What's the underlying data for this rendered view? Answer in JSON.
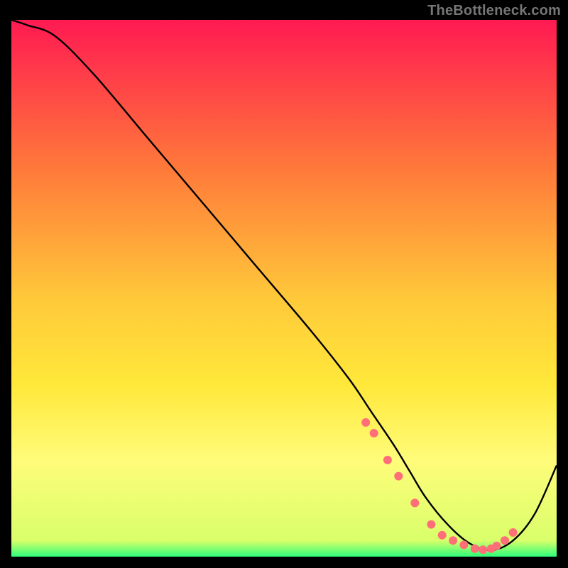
{
  "attribution": "TheBottleneck.com",
  "colors": {
    "black": "#000000",
    "gradient_top": "#ff1a52",
    "gradient_mid1": "#ff7a3a",
    "gradient_mid2": "#ffc93a",
    "gradient_mid3": "#ffe83a",
    "gradient_mid4": "#fffc7a",
    "gradient_bottom": "#2dff7a",
    "curve": "#000000",
    "marker": "#ff6f78"
  },
  "chart_data": {
    "type": "line",
    "title": "",
    "xlabel": "",
    "ylabel": "",
    "xlim": [
      0,
      100
    ],
    "ylim": [
      0,
      100
    ],
    "series": [
      {
        "name": "curve",
        "x": [
          0,
          3,
          8,
          15,
          25,
          35,
          45,
          55,
          62,
          66,
          70,
          73,
          76,
          80,
          84,
          88,
          92,
          96,
          100
        ],
        "y": [
          100,
          99,
          97,
          90,
          78,
          66,
          54,
          42,
          33,
          27,
          21,
          16,
          11,
          6,
          2.5,
          1.2,
          3,
          8,
          17
        ]
      }
    ],
    "markers": {
      "name": "dots",
      "x": [
        65,
        66.5,
        69,
        71,
        74,
        77,
        79,
        81,
        83,
        85,
        86.5,
        88,
        89,
        90.5,
        92
      ],
      "y": [
        25,
        23,
        18,
        15,
        10,
        6,
        4,
        3,
        2.2,
        1.5,
        1.3,
        1.5,
        2,
        3,
        4.5
      ]
    }
  }
}
